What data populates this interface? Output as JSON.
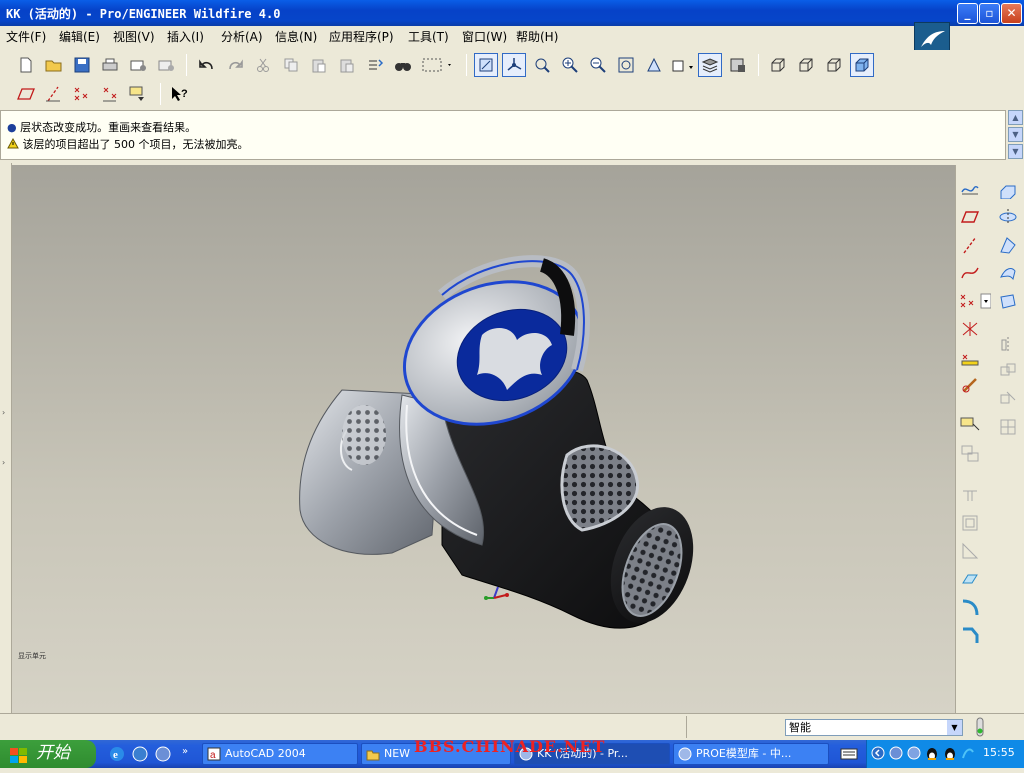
{
  "window": {
    "title": "KK (活动的) - Pro/ENGINEER Wildfire 4.0",
    "minimize": "_",
    "restore": "▫",
    "close": "✕"
  },
  "menu": [
    "文件(F)",
    "编辑(E)",
    "视图(V)",
    "插入(I)",
    "分析(A)",
    "信息(N)",
    "应用程序(P)",
    "工具(T)",
    "窗口(W)",
    "帮助(H)"
  ],
  "messages": {
    "line1": "层状态改变成功。重画来查看结果。",
    "line2": "该层的项目超出了 500 个项目，无法被加亮。"
  },
  "viewport": {
    "corner_label": "显示单元"
  },
  "status": {
    "filter_value": "智能"
  },
  "taskbar": {
    "start": "开始",
    "tasks": [
      {
        "label": "AutoCAD 2004",
        "icon": "autocad-icon"
      },
      {
        "label": "NEW",
        "icon": "folder-icon"
      },
      {
        "label": "KK (活动的) - Pr...",
        "icon": "proe-icon"
      },
      {
        "label": "PROE模型库 - 中...",
        "icon": "browser-icon"
      }
    ],
    "clock": "15:55"
  },
  "watermark": "BBS.CHINADE.NET",
  "colors": {
    "title_blue": "#0a5ee8",
    "model_blue": "#0a2a9c",
    "model_black": "#1a1a1c",
    "model_gray": "#a9aeb6"
  }
}
